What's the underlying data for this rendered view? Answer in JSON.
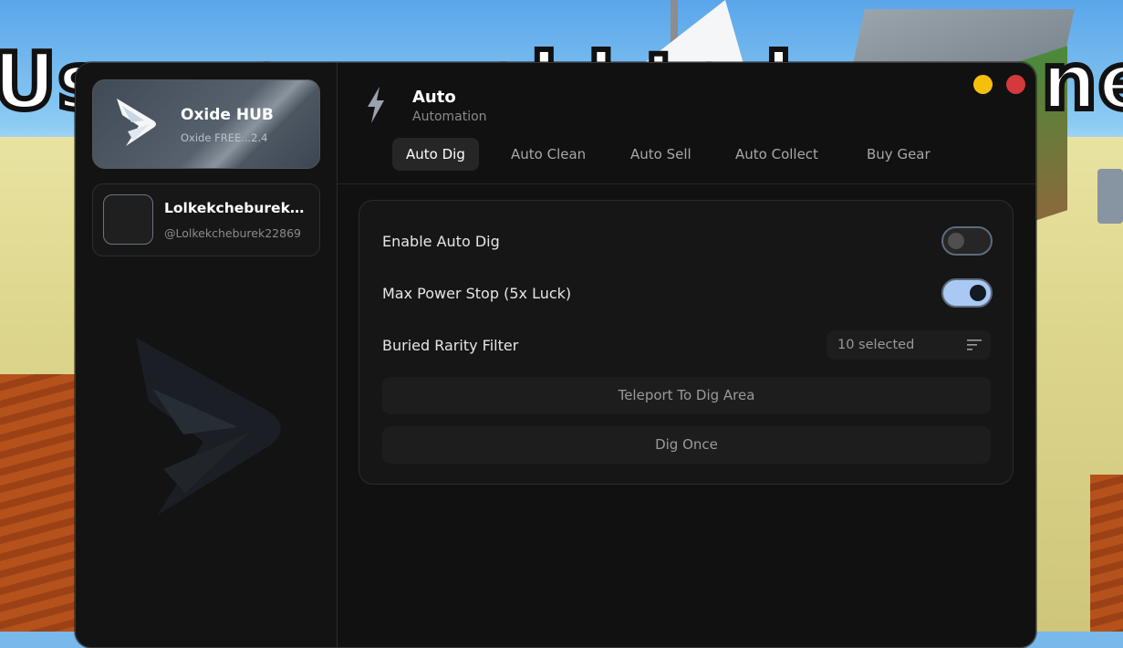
{
  "background": {
    "overlay_text": "Use your gold to buy a new shovel"
  },
  "colors": {
    "window_bg": "#111111",
    "accent_toggle": "#a9c9f3",
    "minimize": "#f5c00c",
    "close": "#d6393b"
  },
  "sidebar": {
    "brand": {
      "logo_icon": "oxide-logo-icon",
      "title": "Oxide HUB",
      "subtitle": "Oxide FREE...2.4"
    },
    "user": {
      "name": "Lolkekcheburek2...",
      "handle": "@Lolkekcheburek22869"
    }
  },
  "header": {
    "icon": "lightning-icon",
    "title": "Auto",
    "subtitle": "Automation"
  },
  "tabs": [
    {
      "label": "Auto Dig",
      "active": true
    },
    {
      "label": "Auto Clean",
      "active": false
    },
    {
      "label": "Auto Sell",
      "active": false
    },
    {
      "label": "Auto Collect",
      "active": false
    },
    {
      "label": "Buy Gear",
      "active": false
    }
  ],
  "panel": {
    "enable_auto_dig": {
      "label": "Enable Auto Dig",
      "on": false
    },
    "max_power_stop": {
      "label": "Max Power Stop (5x Luck)",
      "on": true
    },
    "rarity_filter": {
      "label": "Buried Rarity Filter",
      "value": "10 selected",
      "icon": "filter-list-icon"
    },
    "teleport_button": "Teleport To Dig Area",
    "dig_once_button": "Dig Once"
  }
}
